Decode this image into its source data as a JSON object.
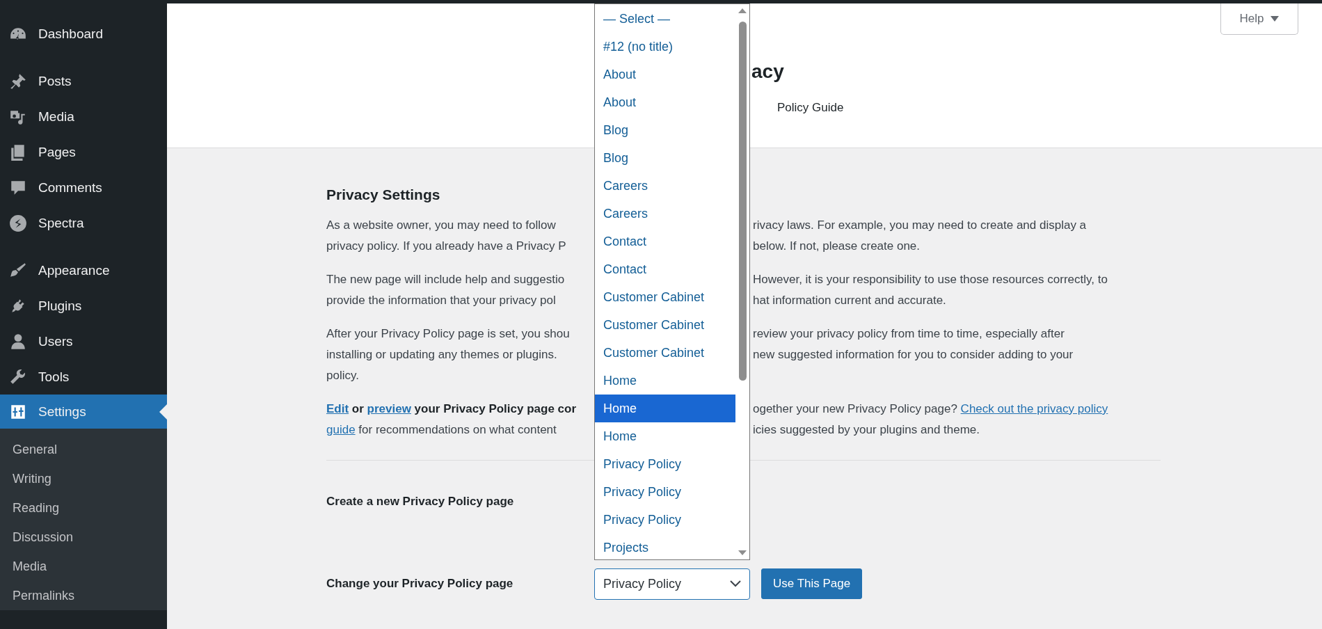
{
  "sidebar": {
    "groups": [
      {
        "items": [
          {
            "label": "Dashboard",
            "selected": false
          }
        ]
      },
      {
        "items": [
          {
            "label": "Posts",
            "selected": false
          },
          {
            "label": "Media",
            "selected": false
          },
          {
            "label": "Pages",
            "selected": false
          },
          {
            "label": "Comments",
            "selected": false
          },
          {
            "label": "Spectra",
            "selected": false
          }
        ]
      },
      {
        "items": [
          {
            "label": "Appearance",
            "selected": false
          },
          {
            "label": "Plugins",
            "selected": false
          },
          {
            "label": "Users",
            "selected": false
          },
          {
            "label": "Tools",
            "selected": false
          },
          {
            "label": "Settings",
            "selected": true,
            "children": [
              {
                "label": "General",
                "selected": false
              },
              {
                "label": "Writing",
                "selected": false
              },
              {
                "label": "Reading",
                "selected": false
              },
              {
                "label": "Discussion",
                "selected": false
              },
              {
                "label": "Media",
                "selected": false
              },
              {
                "label": "Permalinks",
                "selected": false
              }
            ]
          }
        ]
      }
    ]
  },
  "header": {
    "help_button": "Help",
    "title": "acy",
    "tabs": [
      {
        "label": "Policy Guide",
        "selected": false
      }
    ]
  },
  "content": {
    "heading": "Privacy Settings",
    "paragraphs": [
      {
        "lines": [
          {
            "left": [
              {
                "kind": "text",
                "text": "As a website owner, you may need to follow"
              }
            ],
            "right": [
              {
                "kind": "text",
                "text": "rivacy laws. For example, you may need to create and display a"
              }
            ]
          },
          {
            "left": [
              {
                "kind": "text",
                "text": "privacy policy. If you already have a Privacy P"
              }
            ],
            "right": [
              {
                "kind": "text",
                "text": "below. If not, please create one."
              }
            ]
          }
        ]
      },
      {
        "lines": [
          {
            "left": [
              {
                "kind": "text",
                "text": "The new page will include help and suggestio"
              }
            ],
            "right": [
              {
                "kind": "text",
                "text": "However, it is your responsibility to use those resources correctly, to"
              }
            ]
          },
          {
            "left": [
              {
                "kind": "text",
                "text": "provide the information that your privacy pol"
              }
            ],
            "right": [
              {
                "kind": "text",
                "text": "hat information current and accurate."
              }
            ]
          }
        ]
      },
      {
        "lines": [
          {
            "left": [
              {
                "kind": "text",
                "text": "After your Privacy Policy page is set, you shou"
              }
            ],
            "right": [
              {
                "kind": "text",
                "text": "review your privacy policy from time to time, especially after"
              }
            ]
          },
          {
            "left": [
              {
                "kind": "text",
                "text": "installing or updating any themes or plugins."
              }
            ],
            "right": [
              {
                "kind": "text",
                "text": "new suggested information for you to consider adding to your"
              }
            ]
          },
          {
            "left": [
              {
                "kind": "text",
                "text": "policy."
              }
            ]
          }
        ]
      },
      {
        "lines": [
          {
            "left": [
              {
                "kind": "strong_link",
                "text": "Edit"
              },
              {
                "kind": "strong",
                "text": " or "
              },
              {
                "kind": "strong_link",
                "text": "preview"
              },
              {
                "kind": "strong",
                "text": " your Privacy Policy page cor"
              }
            ],
            "right": [
              {
                "kind": "text",
                "text": "ogether your new Privacy Policy page? "
              },
              {
                "kind": "link",
                "text": "Check out the privacy policy"
              }
            ]
          },
          {
            "left": [
              {
                "kind": "link",
                "text": "guide"
              },
              {
                "kind": "text",
                "text": " for recommendations on what content"
              }
            ],
            "right": [
              {
                "kind": "text",
                "text": "icies suggested by your plugins and theme."
              }
            ]
          }
        ]
      }
    ]
  },
  "forms": [
    {
      "label": "Create a new Privacy Policy page"
    },
    {
      "label": "Change your Privacy Policy page",
      "select": {
        "value": "Privacy Policy"
      },
      "button": "Use This Page"
    }
  ],
  "dropdown": {
    "options": [
      {
        "label": "— Select —",
        "selected": false
      },
      {
        "label": "#12 (no title)",
        "selected": false
      },
      {
        "label": "About",
        "selected": false
      },
      {
        "label": "About",
        "selected": false
      },
      {
        "label": "Blog",
        "selected": false
      },
      {
        "label": "Blog",
        "selected": false
      },
      {
        "label": "Careers",
        "selected": false
      },
      {
        "label": "Careers",
        "selected": false
      },
      {
        "label": "Contact",
        "selected": false
      },
      {
        "label": "Contact",
        "selected": false
      },
      {
        "label": "Customer Cabinet",
        "selected": false
      },
      {
        "label": "Customer Cabinet",
        "selected": false
      },
      {
        "label": "Customer Cabinet",
        "selected": false
      },
      {
        "label": "Home",
        "selected": false
      },
      {
        "label": "Home",
        "selected": true
      },
      {
        "label": "Home",
        "selected": false
      },
      {
        "label": "Privacy Policy",
        "selected": false
      },
      {
        "label": "Privacy Policy",
        "selected": false
      },
      {
        "label": "Privacy Policy",
        "selected": false
      },
      {
        "label": "Projects",
        "selected": false
      }
    ]
  }
}
